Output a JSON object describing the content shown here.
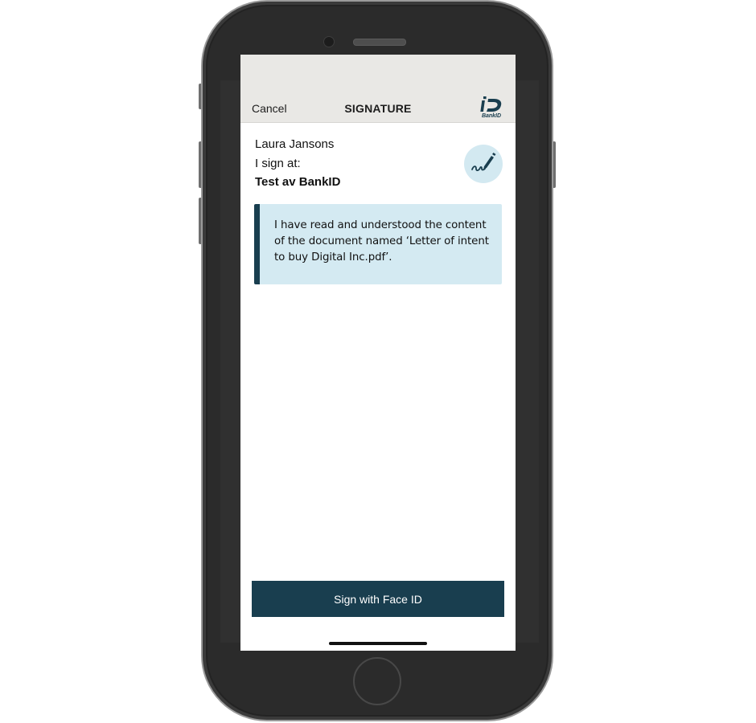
{
  "nav": {
    "cancel_label": "Cancel",
    "title": "SIGNATURE",
    "logo_text": "BankID",
    "logo_icon": "bankid-logo-icon"
  },
  "signer": {
    "name": "Laura Jansons",
    "sign_at_label": "I sign at:",
    "service": "Test av BankID",
    "icon": "signature-pen-icon"
  },
  "message": {
    "text": "I have read and understood the content of the document named ‘Letter of intent to buy Digital Inc.pdf’."
  },
  "actions": {
    "sign_label": "Sign with Face ID"
  },
  "colors": {
    "accent": "#193e4f",
    "message_background": "#d4eaf2",
    "nav_background": "#e9e8e5"
  }
}
